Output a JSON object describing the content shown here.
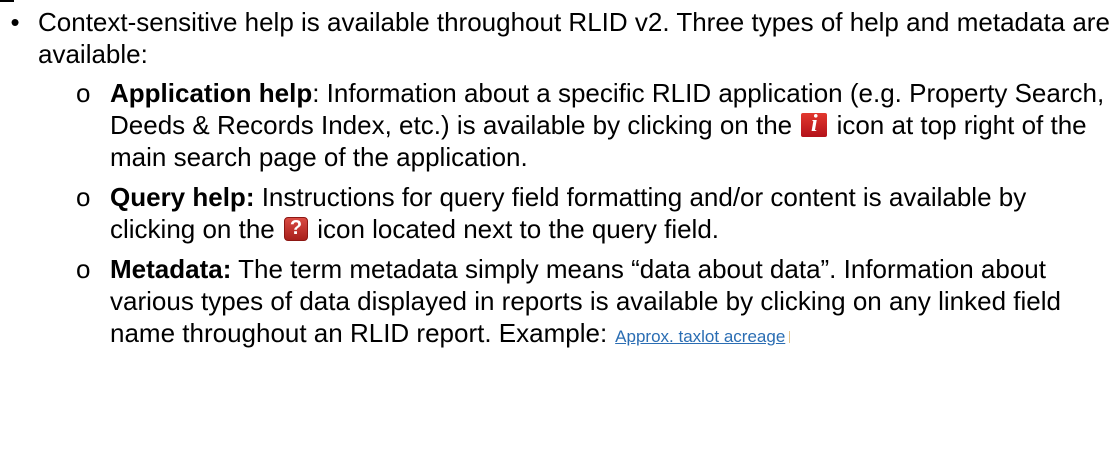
{
  "intro": {
    "bullet": "•",
    "text": "Context-sensitive help is available throughout RLID v2.  Three types of help and metadata are available:"
  },
  "items": [
    {
      "bullet": "o",
      "term": "Application help",
      "text_before_icon": ":  Information about a specific RLID application (e.g. Property Search, Deeds & Records Index, etc.) is available by clicking on the ",
      "icon": "info-icon",
      "icon_glyph": "i",
      "text_after_icon": " icon at top right of the main search page of the application."
    },
    {
      "bullet": "o",
      "term": "Query help:",
      "text_before_icon": "  Instructions for query field formatting and/or content is available by clicking on the ",
      "icon": "help-icon",
      "icon_glyph": "?",
      "text_after_icon": " icon located next to the query field."
    },
    {
      "bullet": "o",
      "term": "Metadata:",
      "text": "  The term metadata simply means “data about data”. Information about various types of data displayed in reports is available by clicking on any linked field name throughout an RLID report.  Example:",
      "example_link": "Approx. taxlot acreage"
    }
  ],
  "colors": {
    "link": "#2a6db3",
    "icon_red": "#c1221c"
  }
}
